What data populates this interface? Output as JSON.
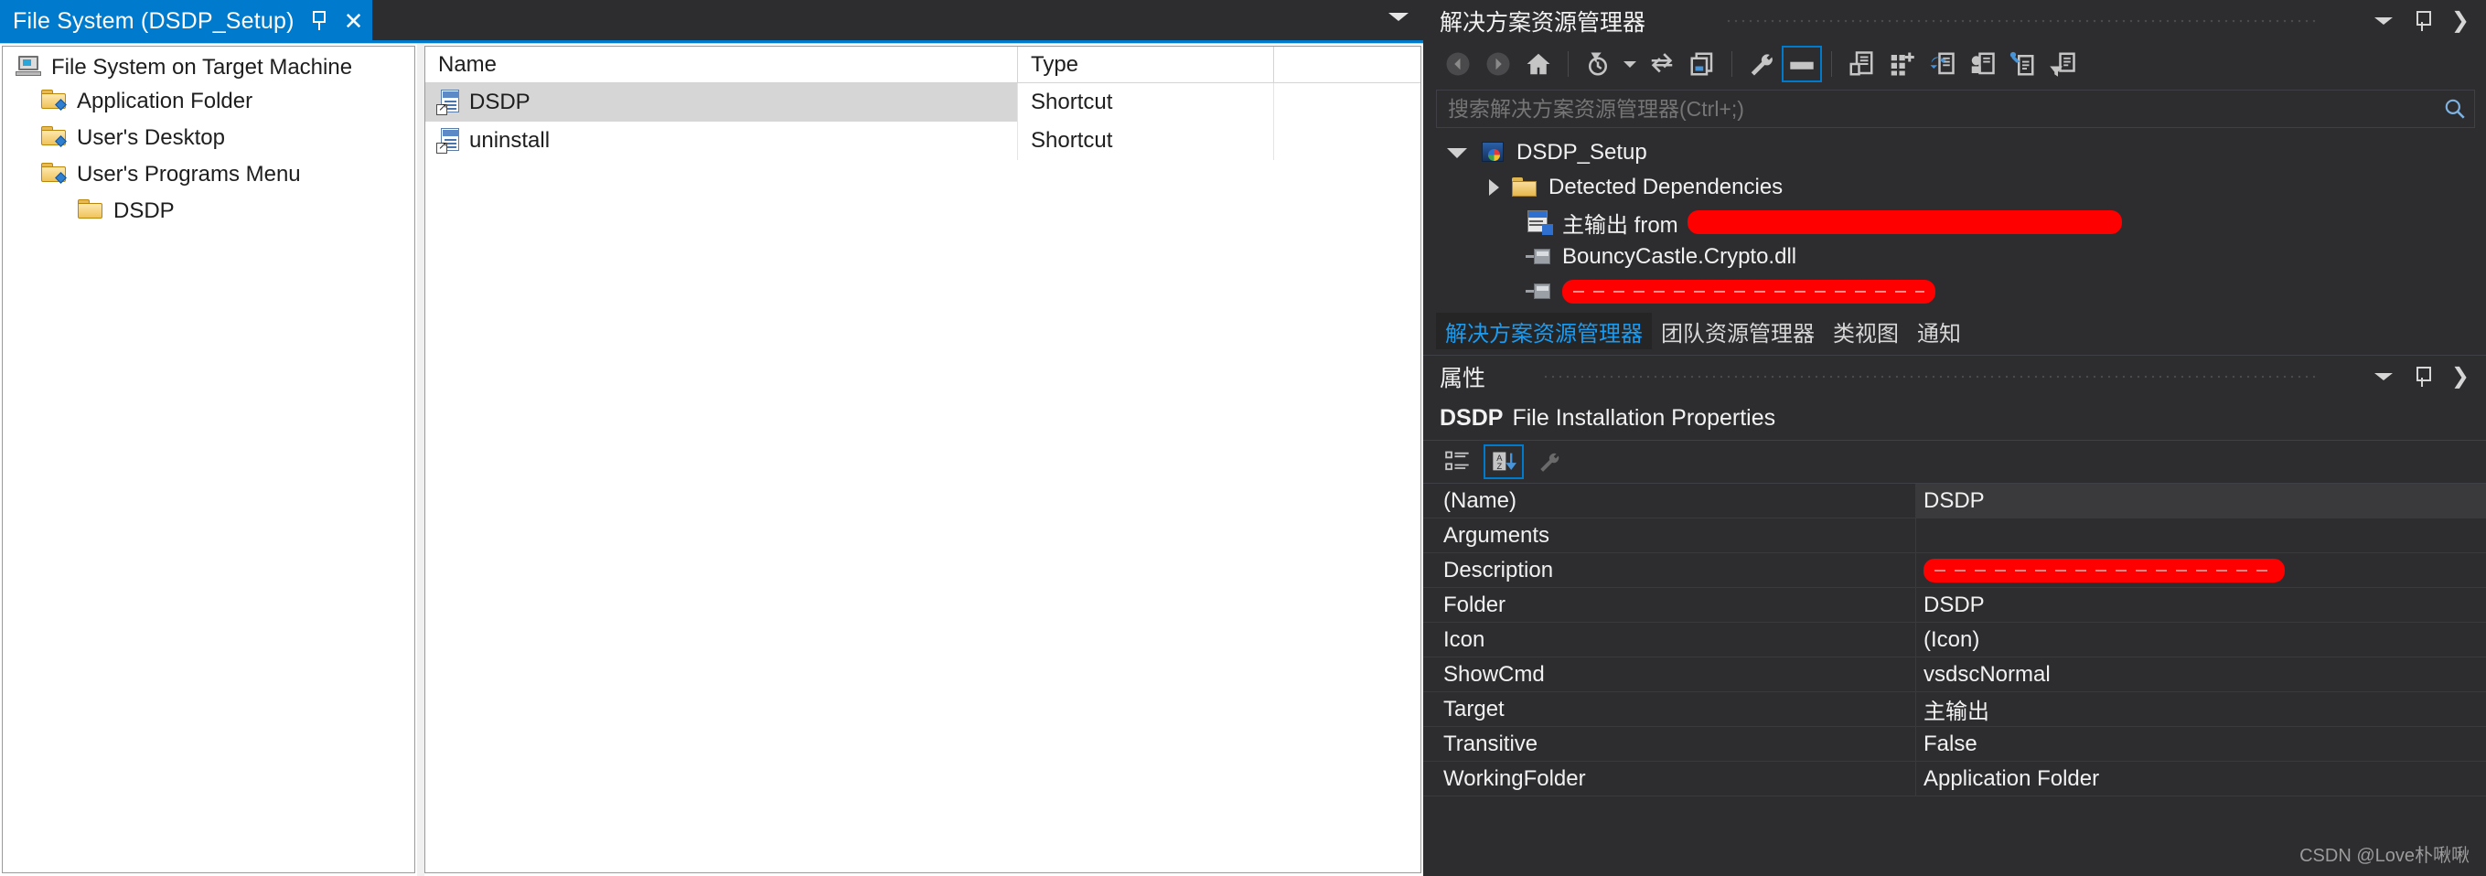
{
  "document": {
    "tab_label": "File System (DSDP_Setup)",
    "pin_icon": "pin-icon",
    "close_icon": "close-icon",
    "overflow_icon": "chevron-down-icon"
  },
  "tree": {
    "root_label": "File System on Target Machine",
    "items": [
      {
        "label": "Application Folder",
        "icon": "folder-icon",
        "indent": 0
      },
      {
        "label": "User's Desktop",
        "icon": "folder-icon",
        "indent": 0
      },
      {
        "label": "User's Programs Menu",
        "icon": "folder-icon",
        "indent": 0
      },
      {
        "label": "DSDP",
        "icon": "folder-icon",
        "indent": 1
      }
    ]
  },
  "filelist": {
    "columns": {
      "name": "Name",
      "type": "Type"
    },
    "rows": [
      {
        "name": "DSDP",
        "type": "Shortcut",
        "icon": "shortcut-icon",
        "selected": true
      },
      {
        "name": "uninstall",
        "type": "Shortcut",
        "icon": "shortcut-icon",
        "selected": false
      }
    ]
  },
  "solution_explorer": {
    "title": "解决方案资源管理器",
    "search_placeholder": "搜索解决方案资源管理器(Ctrl+;)",
    "toolbar": [
      {
        "name": "back-icon",
        "enabled": false
      },
      {
        "name": "forward-icon",
        "enabled": false
      },
      {
        "name": "home-icon",
        "enabled": true
      },
      {
        "name": "pending-changes-filter-icon",
        "enabled": true
      },
      {
        "name": "sync-with-active-document-icon",
        "enabled": true
      },
      {
        "name": "preview-selected-items-icon",
        "enabled": true
      },
      {
        "name": "properties-wrench-icon",
        "enabled": true
      },
      {
        "name": "properties-window-icon",
        "enabled": true,
        "active": true
      },
      {
        "name": "show-all-files-icon",
        "enabled": true
      },
      {
        "name": "add-new-item-icon",
        "enabled": true
      },
      {
        "name": "refresh-icon",
        "enabled": true
      },
      {
        "name": "view-class-diagram-icon",
        "enabled": true
      },
      {
        "name": "view-code-icon",
        "enabled": true
      },
      {
        "name": "filter-icon",
        "enabled": true
      }
    ],
    "tree": [
      {
        "label": "DSDP_Setup",
        "icon": "setup-project-icon",
        "indent": 0,
        "expander": "expanded",
        "redacted": false
      },
      {
        "label": "Detected Dependencies",
        "icon": "folder-icon",
        "indent": 1,
        "expander": "collapsed",
        "redacted": false
      },
      {
        "label": "主输出 from",
        "icon": "primary-output-icon",
        "indent": 1,
        "expander": "none",
        "redacted": true,
        "redact_width": 475
      },
      {
        "label": "BouncyCastle.Crypto.dll",
        "icon": "dependency-icon",
        "indent": 1,
        "expander": "none",
        "redacted": false
      },
      {
        "label": "",
        "icon": "dependency-icon",
        "indent": 1,
        "expander": "none",
        "redacted": true,
        "redact_width": 408,
        "redact_dashed": true
      }
    ],
    "tabs": [
      {
        "label": "解决方案资源管理器",
        "active": true
      },
      {
        "label": "团队资源管理器",
        "active": false
      },
      {
        "label": "类视图",
        "active": false
      },
      {
        "label": "通知",
        "active": false
      }
    ]
  },
  "properties": {
    "title": "属性",
    "subject_bold": "DSDP",
    "subject_rest": "File Installation Properties",
    "toolbar": [
      {
        "name": "categorized-icon",
        "active": false
      },
      {
        "name": "alphabetical-sort-icon",
        "active": true
      },
      {
        "name": "property-pages-icon",
        "active": false
      }
    ],
    "rows": [
      {
        "key": "(Name)",
        "value": "DSDP",
        "redacted": false,
        "highlight": true
      },
      {
        "key": "Arguments",
        "value": "",
        "redacted": false,
        "highlight": false
      },
      {
        "key": "Description",
        "value": "",
        "redacted": true,
        "redact_width": 395,
        "highlight": false
      },
      {
        "key": "Folder",
        "value": "DSDP",
        "redacted": false,
        "highlight": false
      },
      {
        "key": "Icon",
        "value": "(Icon)",
        "redacted": false,
        "highlight": false
      },
      {
        "key": "ShowCmd",
        "value": "vsdscNormal",
        "redacted": false,
        "highlight": false
      },
      {
        "key": "Target",
        "value": "主输出",
        "redacted": false,
        "highlight": false
      },
      {
        "key": "Transitive",
        "value": "False",
        "redacted": false,
        "highlight": false
      },
      {
        "key": "WorkingFolder",
        "value": "Application Folder",
        "redacted": false,
        "highlight": false
      }
    ]
  },
  "watermark": "CSDN @Love朴啾啾",
  "colors": {
    "accent": "#007acc",
    "tab_active_text": "#1b9bf0",
    "redaction": "#ff0000",
    "panel_bg": "#2d2d30",
    "doc_bg": "#ffffff"
  }
}
